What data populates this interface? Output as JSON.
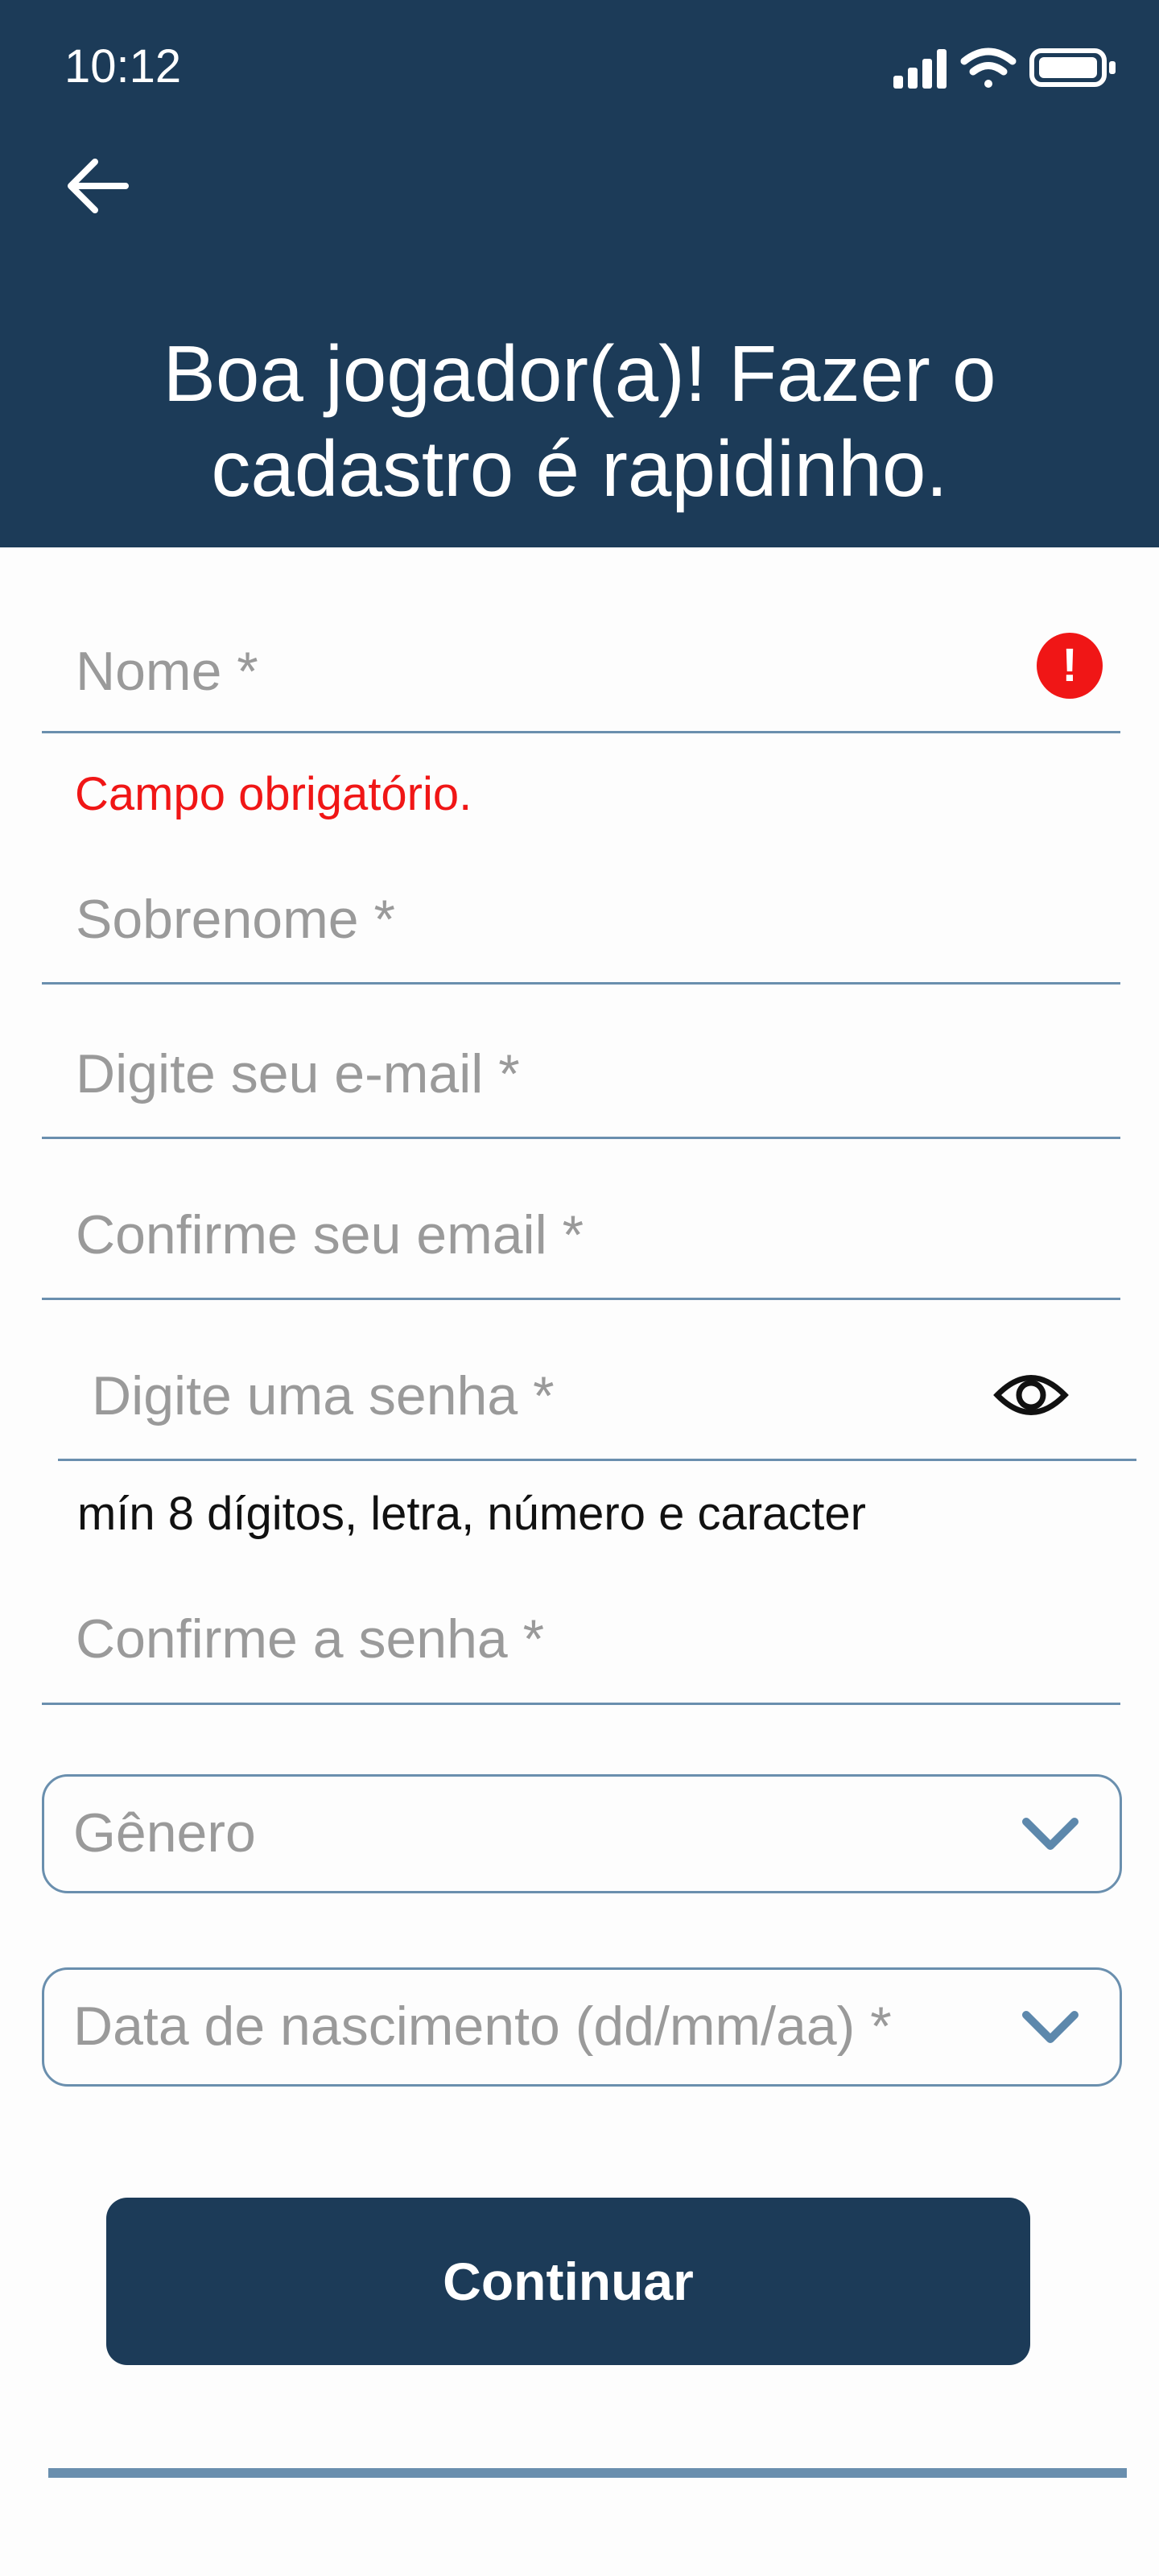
{
  "status_bar": {
    "time": "10:12"
  },
  "header": {
    "back_icon": "arrow-left-icon",
    "title": "Boa jogador(a)! Fazer o cadastro é rapidinho."
  },
  "form": {
    "first_name": {
      "placeholder": "Nome *",
      "value": "",
      "error_icon": "exclamation-icon",
      "error": "Campo obrigatório."
    },
    "last_name": {
      "placeholder": "Sobrenome *",
      "value": ""
    },
    "email": {
      "placeholder": "Digite seu e-mail *",
      "value": ""
    },
    "email_confirm": {
      "placeholder": "Confirme seu email *",
      "value": ""
    },
    "password": {
      "placeholder": "Digite uma senha *",
      "value": "",
      "visibility_icon": "eye-icon",
      "hint": "mín 8 dígitos, letra, número e caracter"
    },
    "password_confirm": {
      "placeholder": "Confirme a senha *",
      "value": ""
    },
    "gender": {
      "placeholder": "Gênero"
    },
    "birth_date": {
      "placeholder": "Data de nascimento (dd/mm/aa) *"
    },
    "continue_label": "Continuar"
  },
  "colors": {
    "primary": "#1c3b58",
    "border": "#6a8fae",
    "error": "#f01616",
    "placeholder": "#9a9a9a"
  }
}
